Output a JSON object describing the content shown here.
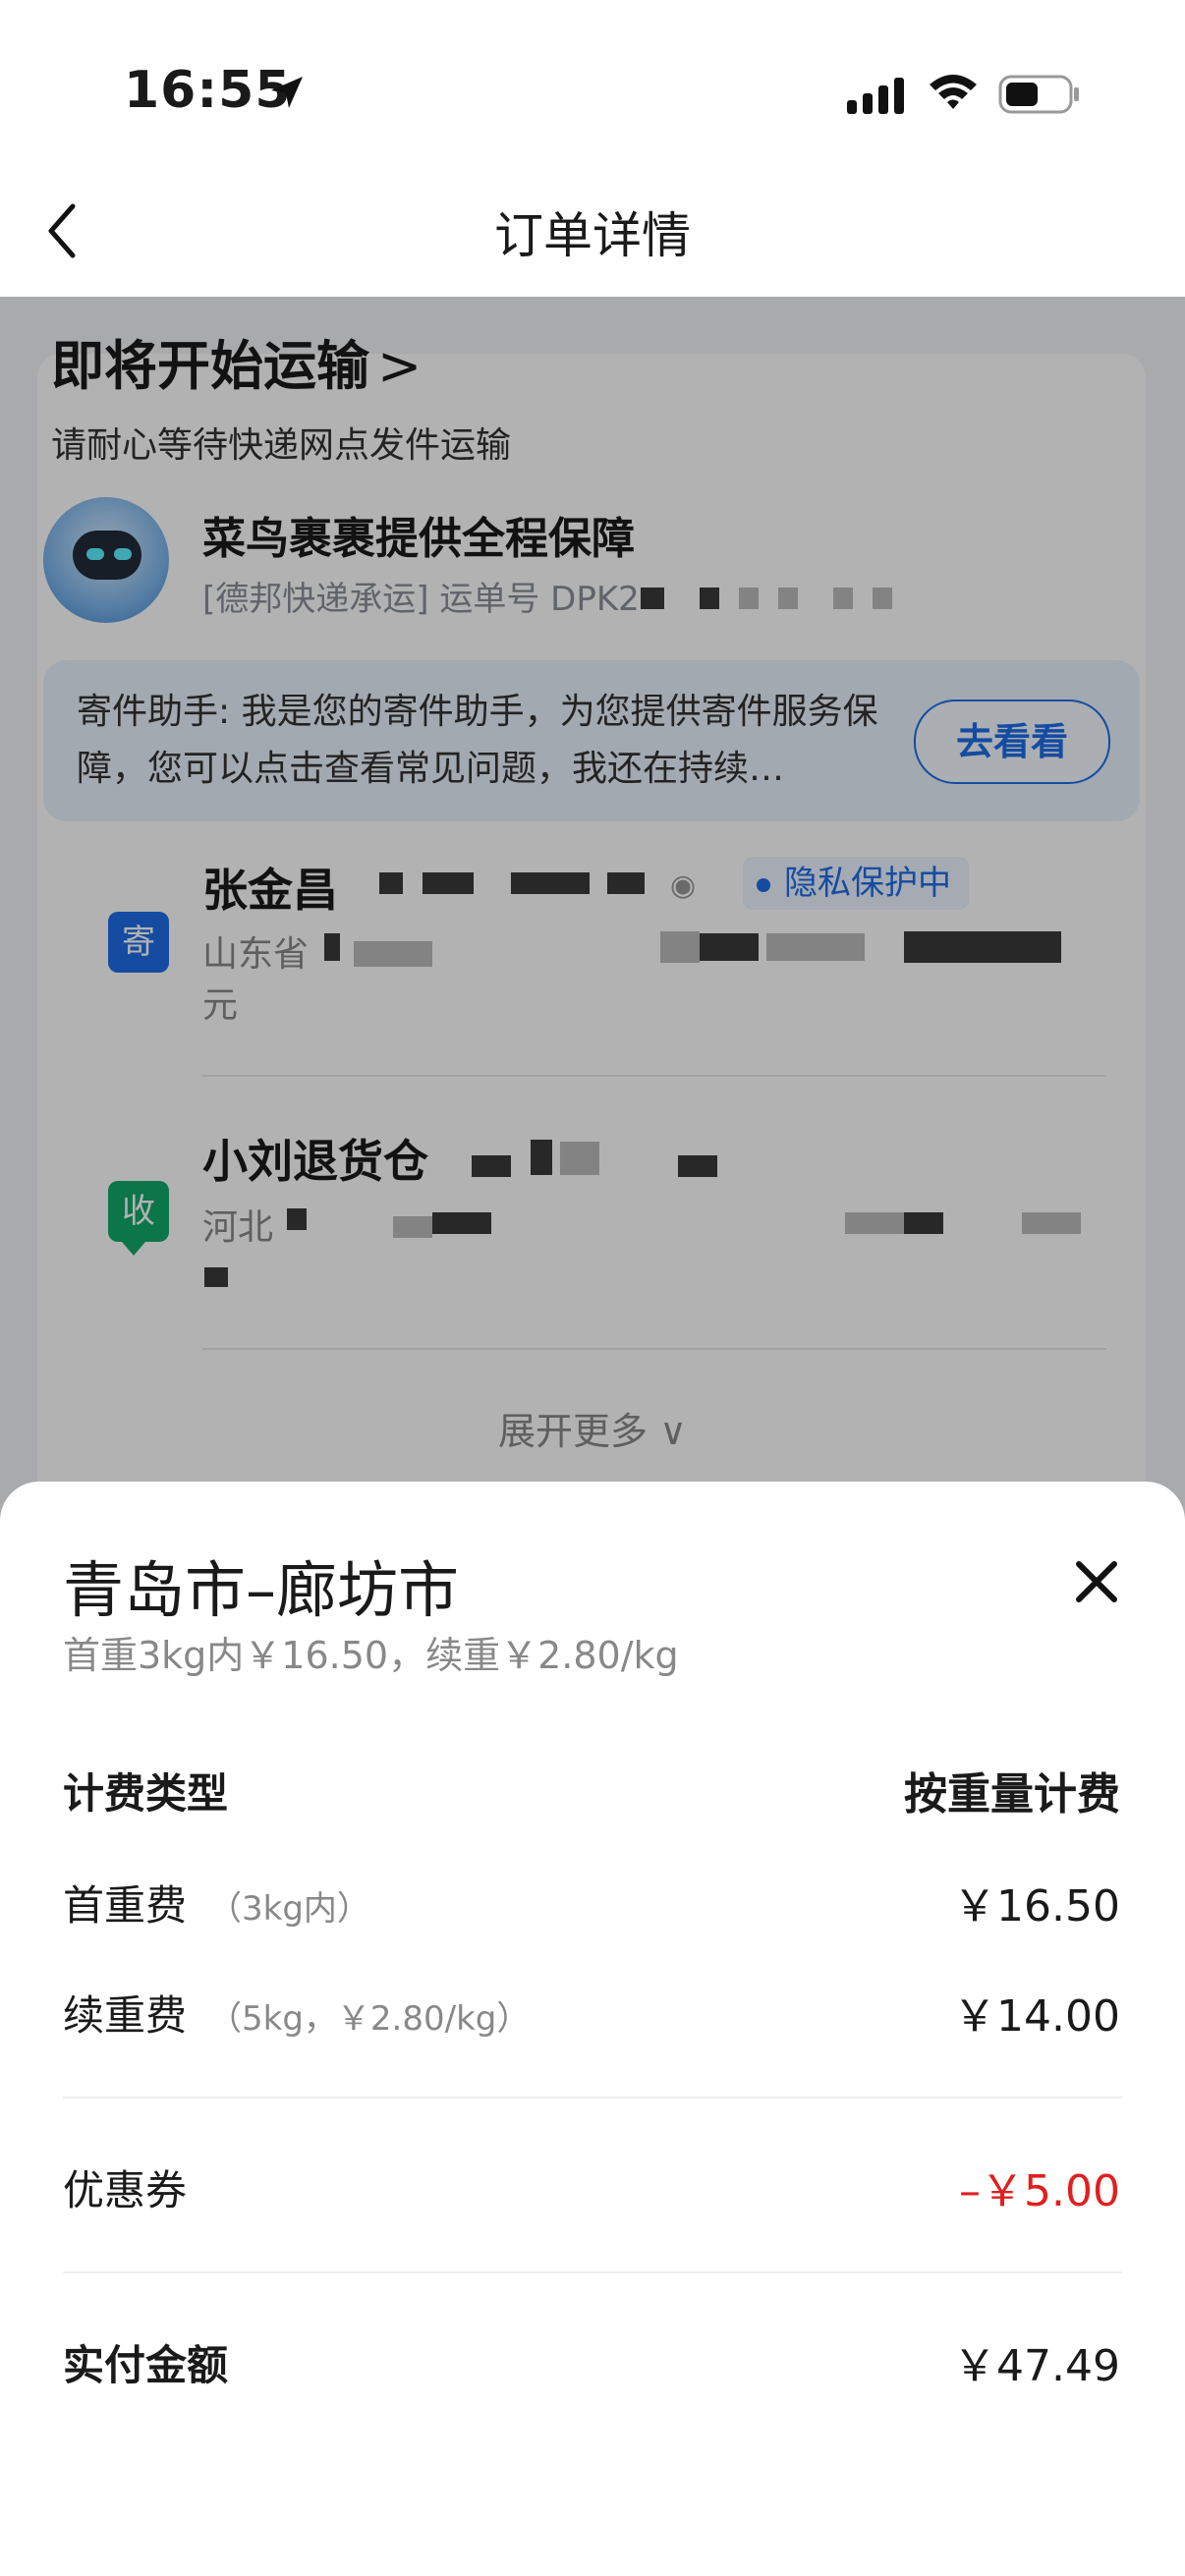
{
  "status_bar": {
    "time": "16:55"
  },
  "nav": {
    "title": "订单详情"
  },
  "order": {
    "status_title": "即将开始运输",
    "status_chevron": ">",
    "status_sub": "请耐心等待快递网点发件运输",
    "guarantee_title": "菜鸟裹裹提供全程保障",
    "waybill_prefix": "[德邦快递承运] 运单号 DPK2",
    "assistant_text": "寄件助手: 我是您的寄件助手，为您提供寄件服务保障，您可以点击查看常见问题，我还在持续…",
    "assistant_button": "去看看",
    "sender": {
      "tag": "寄",
      "name": "张金昌",
      "privacy": "隐私保护中",
      "address_prefix": "山东省",
      "address_line2": "元"
    },
    "receiver": {
      "tag": "收",
      "name": "小刘退货仓",
      "address_prefix": "河北"
    },
    "expand_more": "展开更多 ∨"
  },
  "sheet": {
    "title": "青岛市–廊坊市",
    "subtitle": "首重3kg内￥16.50，续重￥2.80/kg",
    "rows": [
      {
        "label": "计费类型",
        "note": "",
        "value": "按重量计费"
      },
      {
        "label": "首重费",
        "note": "（3kg内）",
        "value": "￥16.50"
      },
      {
        "label": "续重费",
        "note": "（5kg，￥2.80/kg）",
        "value": "￥14.00"
      },
      {
        "label": "优惠券",
        "note": "",
        "value": "–￥5.00"
      },
      {
        "label": "实付金额",
        "note": "",
        "value": "￥47.49"
      }
    ]
  },
  "colors": {
    "accent": "#1f6ee8",
    "discount": "#e02020",
    "receiver_tag": "#12a86a"
  }
}
